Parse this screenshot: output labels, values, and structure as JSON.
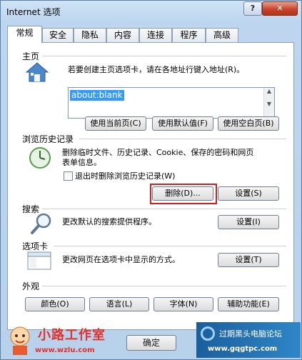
{
  "window": {
    "title": "Internet 选项",
    "help_label": "?",
    "close_label": "✕"
  },
  "tabs": [
    {
      "label": "常规",
      "active": true
    },
    {
      "label": "安全"
    },
    {
      "label": "隐私"
    },
    {
      "label": "内容"
    },
    {
      "label": "连接"
    },
    {
      "label": "程序"
    },
    {
      "label": "高级"
    }
  ],
  "home": {
    "title": "主页",
    "description": "若要创建主页选项卡，请在各地址行键入地址(R)。",
    "value": "about:blank",
    "buttons": [
      "使用当前页(C)",
      "使用默认值(F)",
      "使用空白页(B)"
    ]
  },
  "history": {
    "title": "浏览历史记录",
    "description_line1": "删除临时文件、历史记录、Cookie、保存的密码和网页",
    "description_line2": "表单信息。",
    "checkbox_label": "退出时删除浏览历史记录(W)",
    "delete_button": "删除(D)...",
    "settings_button": "设置(S)"
  },
  "search": {
    "title": "搜索",
    "description": "更改默认的搜索提供程序。",
    "settings_button": "设置(I)"
  },
  "tabsection": {
    "title": "选项卡",
    "description": "更改网页在选项卡中显示的方式。",
    "settings_button": "设置(T)"
  },
  "appearance": {
    "title": "外观",
    "buttons": [
      "颜色(O)",
      "语言(L)",
      "字体(N)",
      "辅助功能(E)"
    ]
  },
  "footer": {
    "ok_button": "确定"
  },
  "watermarks": {
    "left_brand": "小路工作室",
    "left_url": "www.wzlu.com",
    "right_line1": "过期黑头电脑论坛",
    "right_line2": "www.gqgtpc.com"
  },
  "colors": {
    "accent_selection": "#3399ff",
    "highlight_border": "#c62222",
    "window_frame": "#bdd5ee"
  }
}
